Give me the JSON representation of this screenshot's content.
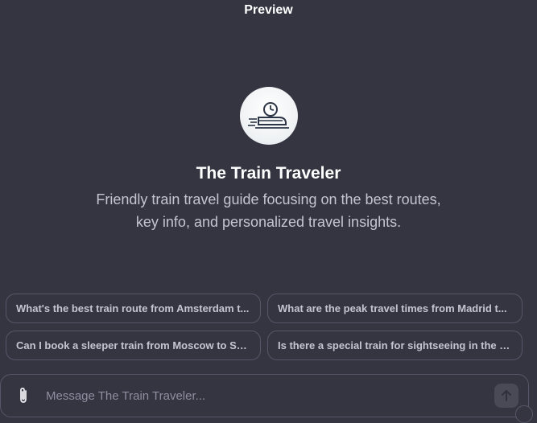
{
  "header": {
    "title": "Preview"
  },
  "gpt": {
    "icon": "train-clock-icon",
    "name": "The Train Traveler",
    "description": "Friendly train travel guide focusing on the best routes, key info, and personalized travel insights."
  },
  "prompts": [
    {
      "label": "What's the best train route from Amsterdam t..."
    },
    {
      "label": "What are the peak travel times from Madrid t..."
    },
    {
      "label": "Can I book a sleeper train from Moscow to St...."
    },
    {
      "label": "Is there a special train for sightseeing in the S..."
    }
  ],
  "composer": {
    "placeholder": "Message The Train Traveler...",
    "value": "",
    "attach_icon": "paperclip-icon",
    "send_icon": "arrow-up-icon"
  },
  "colors": {
    "background": "#343541",
    "border": "#565869",
    "text": "#ececf1",
    "muted_text": "#c5c5d2",
    "icon_stroke": "#2b3545"
  }
}
